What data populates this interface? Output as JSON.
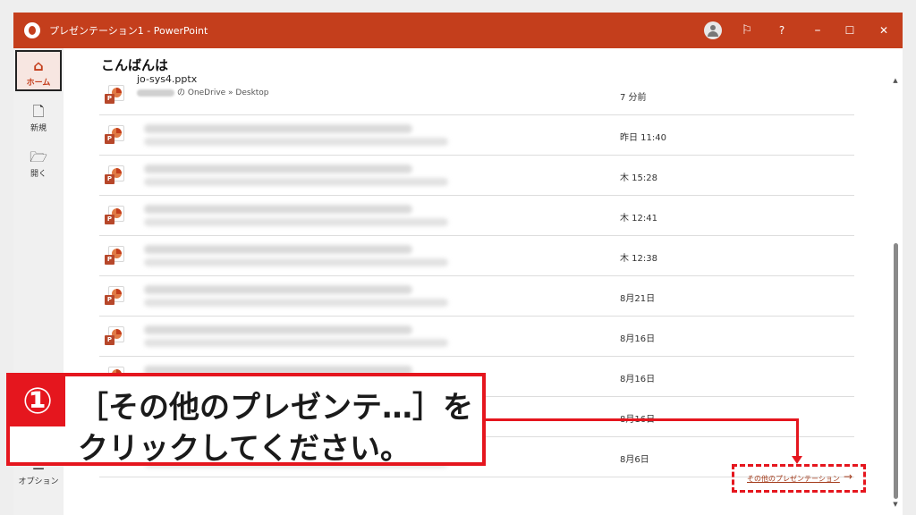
{
  "titlebar": {
    "title": "プレゼンテーション1  -  PowerPoint",
    "icons": [
      "app-logo",
      "account-avatar",
      "feedback-icon",
      "help-icon",
      "minimize-icon",
      "maximize-icon",
      "close-icon"
    ],
    "feedback_glyph": "⚐",
    "help_glyph": "?",
    "minimize_glyph": "–",
    "maximize_glyph": "☐",
    "close_glyph": "✕"
  },
  "sidebar": {
    "items": [
      {
        "label": "ホーム",
        "icon": "home-icon",
        "glyph": "⌂"
      },
      {
        "label": "新規",
        "icon": "new-file-icon",
        "glyph": "🗋"
      },
      {
        "label": "開く",
        "icon": "open-folder-icon",
        "glyph": "🗁"
      },
      {
        "label": "オプション",
        "icon": "options-icon",
        "glyph": "☰"
      }
    ]
  },
  "main": {
    "greeting": "こんばんは",
    "files": [
      {
        "name": "jo-sys4.pptx",
        "path": "の OneDrive » Desktop",
        "date": "7 分前"
      },
      {
        "date": "昨日 11:40"
      },
      {
        "date": "木 15:28"
      },
      {
        "date": "木 12:41"
      },
      {
        "date": "木 12:38"
      },
      {
        "date": "8月21日"
      },
      {
        "date": "8月16日"
      },
      {
        "date": "8月16日"
      },
      {
        "date": "8月16日"
      },
      {
        "date": "8月6日"
      }
    ],
    "file_badge": "P",
    "more_link": "その他のプレゼンテーション",
    "more_arrow": "→"
  },
  "callout": {
    "number": "①",
    "line1": "［その他のプレゼンテ…］を",
    "line2": "クリックしてください。"
  },
  "colors": {
    "accent": "#c43e1c",
    "annotation_red": "#e5161e"
  }
}
